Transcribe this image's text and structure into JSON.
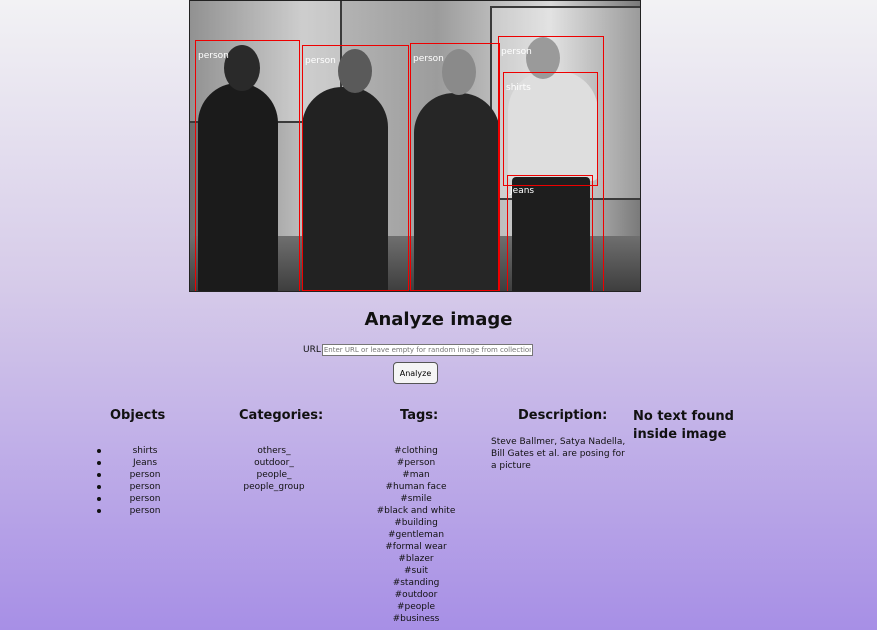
{
  "detections": [
    {
      "label": "person"
    },
    {
      "label": "person"
    },
    {
      "label": "person"
    },
    {
      "label": "person"
    },
    {
      "label": "shirts"
    },
    {
      "label": "Jeans"
    }
  ],
  "form": {
    "title": "Analyze image",
    "url_label": "URL",
    "url_placeholder": "Enter URL or leave empty for random image from collection",
    "url_value": "",
    "button_label": "Analyze"
  },
  "objects": {
    "heading": "Objects",
    "items": [
      "shirts",
      "Jeans",
      "person",
      "person",
      "person",
      "person"
    ]
  },
  "categories": {
    "heading": "Categories:",
    "items": [
      "others_",
      "outdoor_",
      "people_",
      "people_group"
    ]
  },
  "tags": {
    "heading": "Tags:",
    "items": [
      "#clothing",
      "#person",
      "#man",
      "#human face",
      "#smile",
      "#black and white",
      "#building",
      "#gentleman",
      "#formal wear",
      "#blazer",
      "#suit",
      "#standing",
      "#outdoor",
      "#people",
      "#business"
    ]
  },
  "description": {
    "heading": "Description:",
    "text": "Steve Ballmer, Satya Nadella, Bill Gates et al. are posing for a picture"
  },
  "text_result": {
    "heading": "No text found inside image"
  }
}
